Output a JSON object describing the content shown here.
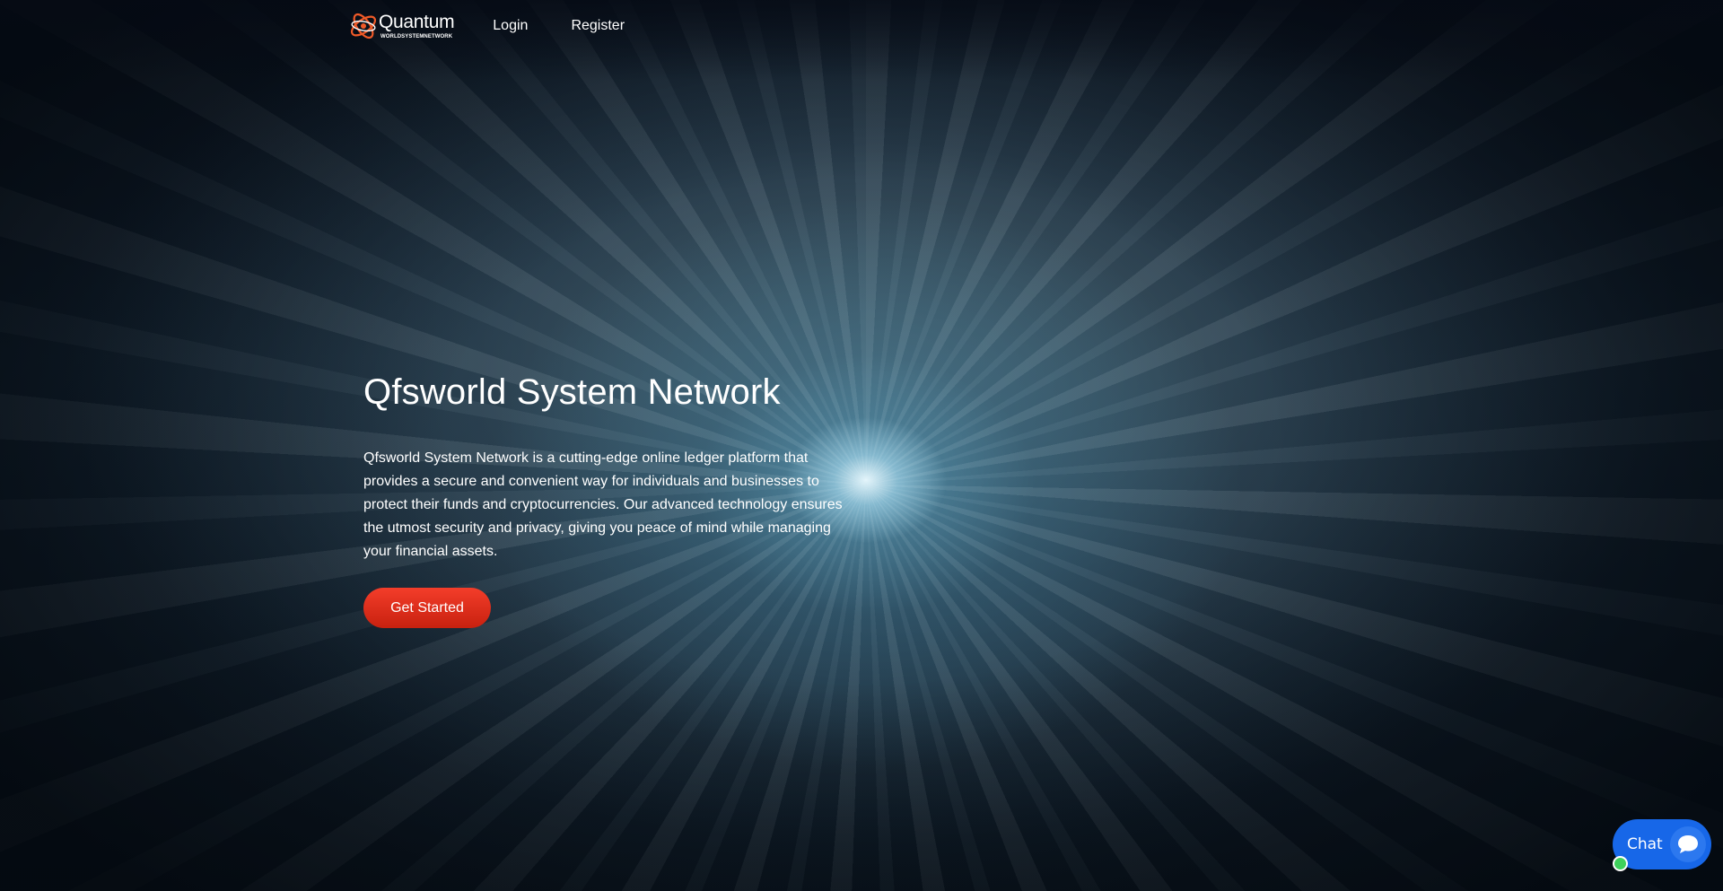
{
  "header": {
    "logo": {
      "title": "Quantum",
      "subtitle": "WORLDSYSTEMNETWORK",
      "icon": "atom-orbit-logo",
      "accent_color": "#f05a28"
    },
    "nav": [
      {
        "label": "Login"
      },
      {
        "label": "Register"
      }
    ]
  },
  "hero": {
    "title": "Qfsworld System Network",
    "description": "Qfsworld System Network is a cutting-edge online ledger platform that provides a secure and convenient way for individuals and businesses to protect their funds and cryptocurrencies. Our advanced technology ensures the utmost security and privacy, giving you peace of mind while managing your financial assets.",
    "cta_label": "Get Started",
    "cta_color": "#e5301c"
  },
  "chat_widget": {
    "label": "Chat",
    "icon": "speech-bubble-icon",
    "color": "#1767e8",
    "status_color": "#3ed15b"
  }
}
